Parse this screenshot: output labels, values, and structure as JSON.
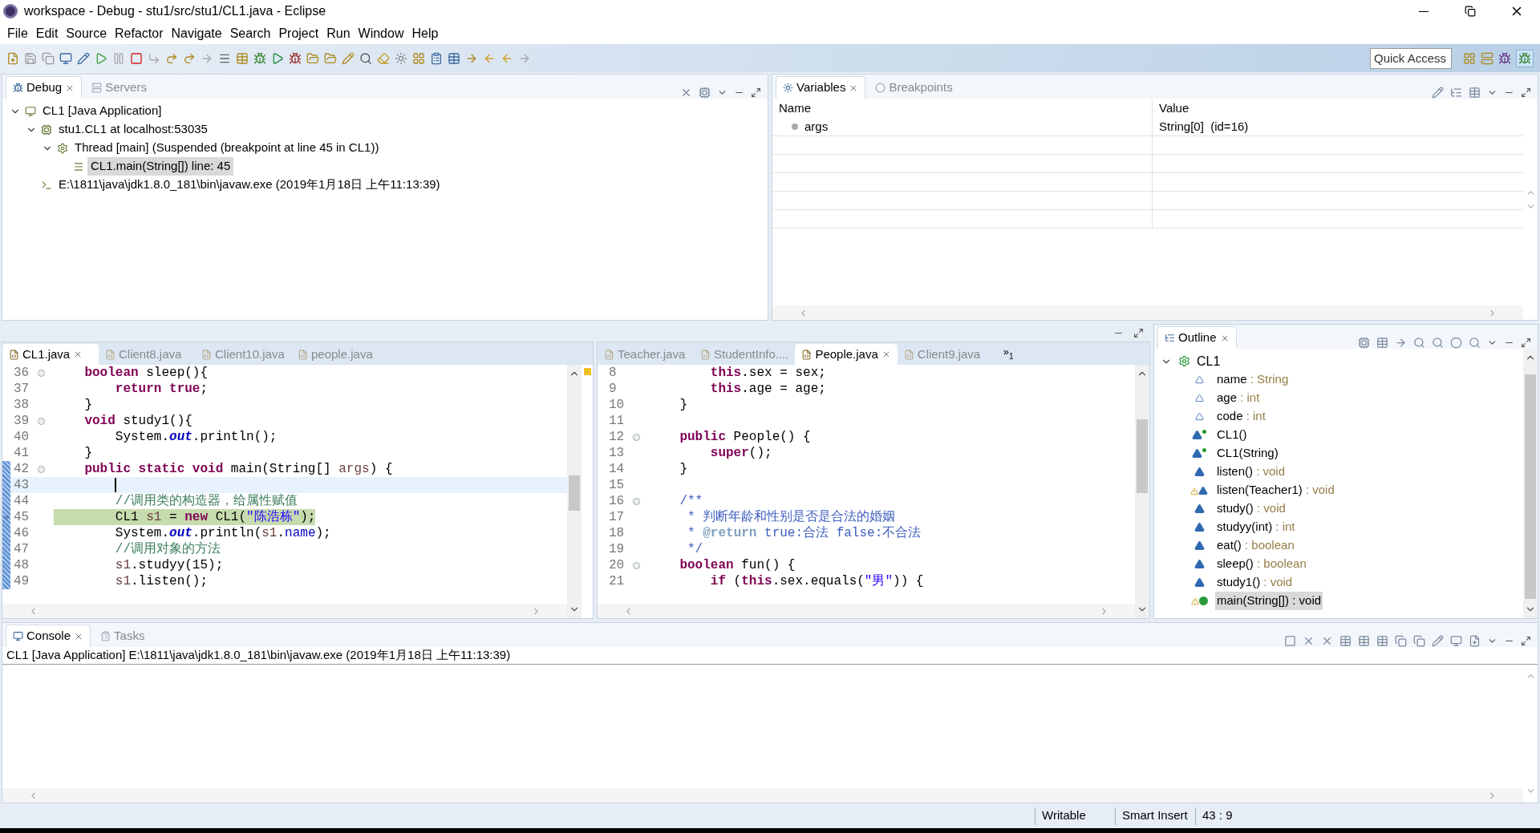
{
  "window": {
    "title": "workspace - Debug - stu1/src/stu1/CL1.java - Eclipse"
  },
  "menu": [
    "File",
    "Edit",
    "Source",
    "Refactor",
    "Navigate",
    "Search",
    "Project",
    "Run",
    "Window",
    "Help"
  ],
  "quick_access": {
    "placeholder": "Quick Access"
  },
  "debug_view": {
    "tabs": [
      {
        "label": "Debug",
        "selected": true
      },
      {
        "label": "Servers",
        "selected": false
      }
    ],
    "tree": [
      {
        "label": "CL1 [Java Application]",
        "kind": "launch",
        "expanded": true,
        "selected": false,
        "children": [
          {
            "label": "stu1.CL1 at localhost:53035",
            "kind": "target",
            "expanded": true,
            "selected": false,
            "children": [
              {
                "label": "Thread [main] (Suspended (breakpoint at line 45 in CL1))",
                "kind": "thread",
                "expanded": true,
                "selected": false,
                "children": [
                  {
                    "label": "CL1.main(String[]) line: 45",
                    "kind": "frame",
                    "selected": true
                  }
                ]
              }
            ]
          },
          {
            "label": "E:\\1811\\java\\jdk1.8.0_181\\bin\\javaw.exe (2019年1月18日 上午11:13:39)",
            "kind": "process",
            "selected": false
          }
        ]
      }
    ]
  },
  "variables_view": {
    "tabs": [
      {
        "label": "Variables",
        "selected": true
      },
      {
        "label": "Breakpoints",
        "selected": false
      }
    ],
    "columns": [
      "Name",
      "Value"
    ],
    "rows": [
      {
        "name": "args",
        "value": "String[0]  (id=16)"
      }
    ]
  },
  "editor_left": {
    "tabs": [
      {
        "label": "CL1.java",
        "selected": true
      },
      {
        "label": "Client8.java",
        "selected": false
      },
      {
        "label": "Client10.java",
        "selected": false
      },
      {
        "label": "people.java",
        "selected": false
      }
    ],
    "lines": [
      {
        "number": "36",
        "fold": true,
        "tokens": [
          {
            "text": "    boolean",
            "kind": "keyword"
          },
          {
            "text": " sleep(){",
            "kind": "plain"
          }
        ]
      },
      {
        "number": "37",
        "tokens": [
          {
            "text": "        return true",
            "kind": "keyword"
          },
          {
            "text": ";",
            "kind": "plain"
          }
        ]
      },
      {
        "number": "38",
        "tokens": [
          {
            "text": "    }",
            "kind": "plain"
          }
        ]
      },
      {
        "number": "39",
        "fold": true,
        "tokens": [
          {
            "text": "    void",
            "kind": "keyword"
          },
          {
            "text": " study1(){",
            "kind": "plain"
          }
        ]
      },
      {
        "number": "40",
        "tokens": [
          {
            "text": "        System.",
            "kind": "plain"
          },
          {
            "text": "out",
            "kind": "static"
          },
          {
            "text": ".println();",
            "kind": "plain"
          }
        ]
      },
      {
        "number": "41",
        "tokens": [
          {
            "text": "    }",
            "kind": "plain"
          }
        ]
      },
      {
        "number": "42",
        "fold": true,
        "tokens": [
          {
            "text": "    public static void",
            "kind": "keyword"
          },
          {
            "text": " main(String[] ",
            "kind": "plain"
          },
          {
            "text": "args",
            "kind": "local"
          },
          {
            "text": ") {",
            "kind": "plain"
          }
        ]
      },
      {
        "number": "43",
        "caret": true
      },
      {
        "number": "44",
        "tokens": [
          {
            "text": "        //调用类的构造器，给属性赋值",
            "kind": "comment"
          }
        ]
      },
      {
        "number": "45",
        "execution_point": true,
        "tokens": [
          {
            "text": "        CL1 ",
            "kind": "plain"
          },
          {
            "text": "s1",
            "kind": "local"
          },
          {
            "text": " = ",
            "kind": "plain"
          },
          {
            "text": "new",
            "kind": "keyword"
          },
          {
            "text": " CL1(",
            "kind": "plain"
          },
          {
            "text": "\"陈浩栋\"",
            "kind": "string"
          },
          {
            "text": ");",
            "kind": "plain"
          }
        ]
      },
      {
        "number": "46",
        "tokens": [
          {
            "text": "        System.",
            "kind": "plain"
          },
          {
            "text": "out",
            "kind": "static"
          },
          {
            "text": ".println(",
            "kind": "plain"
          },
          {
            "text": "s1",
            "kind": "local"
          },
          {
            "text": ".",
            "kind": "plain"
          },
          {
            "text": "name",
            "kind": "field"
          },
          {
            "text": ");",
            "kind": "plain"
          }
        ]
      },
      {
        "number": "47",
        "tokens": [
          {
            "text": "        //调用对象的方法",
            "kind": "comment"
          }
        ]
      },
      {
        "number": "48",
        "tokens": [
          {
            "text": "        s1",
            "kind": "local"
          },
          {
            "text": ".studyy(15);",
            "kind": "plain"
          }
        ]
      },
      {
        "number": "49",
        "tokens": [
          {
            "text": "        s1",
            "kind": "local"
          },
          {
            "text": ".listen();",
            "kind": "plain"
          }
        ]
      }
    ]
  },
  "editor_right": {
    "tabs": [
      {
        "label": "Teacher.java",
        "selected": false
      },
      {
        "label": "StudentInfo....",
        "selected": false
      },
      {
        "label": "People.java",
        "selected": true
      },
      {
        "label": "Client9.java",
        "selected": false
      }
    ],
    "overflow": {
      "mark": "»",
      "count": "1"
    },
    "lines": [
      {
        "number": "8",
        "tokens": [
          {
            "text": "        this",
            "kind": "keyword"
          },
          {
            "text": ".sex = sex;",
            "kind": "plain"
          }
        ]
      },
      {
        "number": "9",
        "tokens": [
          {
            "text": "        this",
            "kind": "keyword"
          },
          {
            "text": ".age = age;",
            "kind": "plain"
          }
        ]
      },
      {
        "number": "10",
        "tokens": [
          {
            "text": "    }",
            "kind": "plain"
          }
        ]
      },
      {
        "number": "11"
      },
      {
        "number": "12",
        "fold": true,
        "tokens": [
          {
            "text": "    public",
            "kind": "keyword"
          },
          {
            "text": " People() {",
            "kind": "plain"
          }
        ]
      },
      {
        "number": "13",
        "tokens": [
          {
            "text": "        super",
            "kind": "keyword"
          },
          {
            "text": "();",
            "kind": "plain"
          }
        ]
      },
      {
        "number": "14",
        "tokens": [
          {
            "text": "    }",
            "kind": "plain"
          }
        ]
      },
      {
        "number": "15"
      },
      {
        "number": "16",
        "fold": true,
        "tokens": [
          {
            "text": "    /**",
            "kind": "javadoc"
          }
        ]
      },
      {
        "number": "17",
        "tokens": [
          {
            "text": "     * 判断年龄和性别是否是合法的婚姻",
            "kind": "javadoc"
          }
        ]
      },
      {
        "number": "18",
        "tokens": [
          {
            "text": "     * ",
            "kind": "javadoc"
          },
          {
            "text": "@return",
            "kind": "javadoc_tag"
          },
          {
            "text": " true:合法 false:不合法",
            "kind": "javadoc"
          }
        ]
      },
      {
        "number": "19",
        "tokens": [
          {
            "text": "     */",
            "kind": "javadoc"
          }
        ]
      },
      {
        "number": "20",
        "fold": true,
        "tokens": [
          {
            "text": "    boolean",
            "kind": "keyword"
          },
          {
            "text": " fun() {",
            "kind": "plain"
          }
        ]
      },
      {
        "number": "21",
        "tokens": [
          {
            "text": "        if",
            "kind": "keyword"
          },
          {
            "text": " (",
            "kind": "plain"
          },
          {
            "text": "this",
            "kind": "keyword"
          },
          {
            "text": ".sex.equals(",
            "kind": "plain"
          },
          {
            "text": "\"男\"",
            "kind": "string"
          },
          {
            "text": ")) {",
            "kind": "plain"
          }
        ]
      }
    ]
  },
  "outline": {
    "tab": {
      "label": "Outline",
      "selected": true
    },
    "root": {
      "label": "CL1",
      "expanded": true,
      "children": [
        {
          "label": "name",
          "type": ": String",
          "kind": "field",
          "selected": false
        },
        {
          "label": "age",
          "type": ": int",
          "kind": "field",
          "selected": false
        },
        {
          "label": "code",
          "type": ": int",
          "kind": "field",
          "selected": false
        },
        {
          "label": "CL1()",
          "kind": "constructor",
          "selected": false
        },
        {
          "label": "CL1(String)",
          "kind": "constructor",
          "selected": false
        },
        {
          "label": "listen()",
          "type": ": void",
          "kind": "method",
          "selected": false
        },
        {
          "label": "listen(Teacher1)",
          "type": ": void",
          "kind": "method_warning",
          "selected": false
        },
        {
          "label": "study()",
          "type": ": void",
          "kind": "method",
          "selected": false
        },
        {
          "label": "studyy(int)",
          "type": ": int",
          "kind": "method",
          "selected": false
        },
        {
          "label": "eat()",
          "type": ": boolean",
          "kind": "method",
          "selected": false
        },
        {
          "label": "sleep()",
          "type": ": boolean",
          "kind": "method",
          "selected": false
        },
        {
          "label": "study1()",
          "type": ": void",
          "kind": "method",
          "selected": false
        },
        {
          "label": "main(String[])",
          "type": ": void",
          "kind": "main",
          "selected": true
        }
      ]
    }
  },
  "console": {
    "tabs": [
      {
        "label": "Console",
        "selected": true
      },
      {
        "label": "Tasks",
        "selected": false
      }
    ],
    "header": "CL1 [Java Application] E:\\1811\\java\\jdk1.8.0_181\\bin\\javaw.exe (2019年1月18日 上午11:13:39)"
  },
  "status_bar": [
    "Writable",
    "Smart Insert",
    "43 : 9"
  ]
}
